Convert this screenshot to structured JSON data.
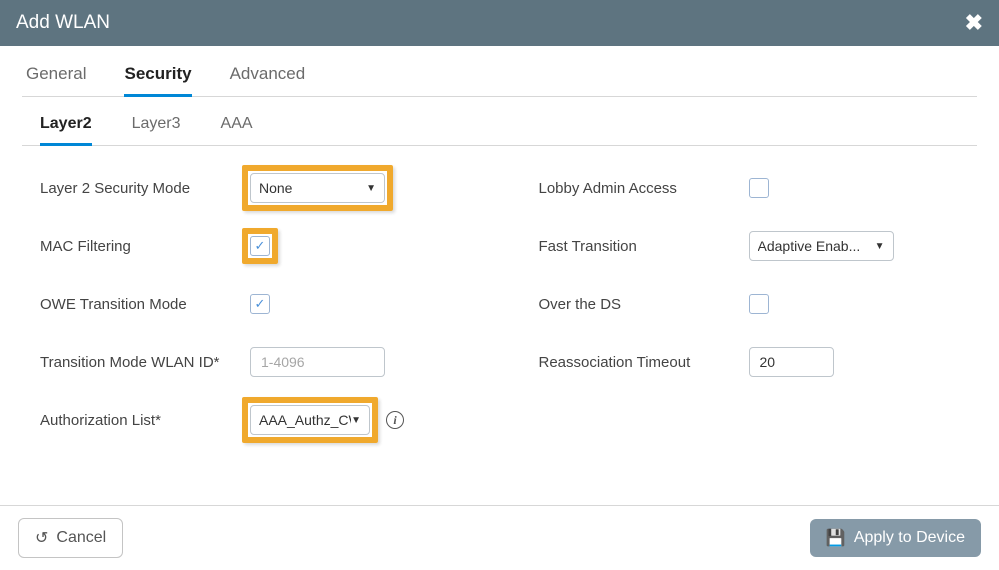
{
  "modal": {
    "title": "Add WLAN"
  },
  "tabs": {
    "general": "General",
    "security": "Security",
    "advanced": "Advanced",
    "active": "security"
  },
  "subtabs": {
    "layer2": "Layer2",
    "layer3": "Layer3",
    "aaa": "AAA",
    "active": "layer2"
  },
  "left": {
    "l2mode_label": "Layer 2 Security Mode",
    "l2mode_value": "None",
    "mac_filtering_label": "MAC Filtering",
    "mac_filtering_checked": true,
    "owe_label": "OWE Transition Mode",
    "owe_checked": true,
    "tmwlan_label": "Transition Mode WLAN ID*",
    "tmwlan_placeholder": "1-4096",
    "tmwlan_value": "",
    "authz_label": "Authorization List*",
    "authz_value": "AAA_Authz_CW..."
  },
  "right": {
    "lobby_label": "Lobby Admin Access",
    "lobby_checked": false,
    "ft_label": "Fast Transition",
    "ft_value": "Adaptive Enab...",
    "otd_label": "Over the DS",
    "otd_checked": false,
    "reassoc_label": "Reassociation Timeout",
    "reassoc_value": "20"
  },
  "footer": {
    "cancel": "Cancel",
    "apply": "Apply to Device"
  },
  "icons": {
    "check": "✓",
    "caret": "▼",
    "undo": "↺",
    "save": "💾",
    "close": "✖",
    "info": "i"
  }
}
